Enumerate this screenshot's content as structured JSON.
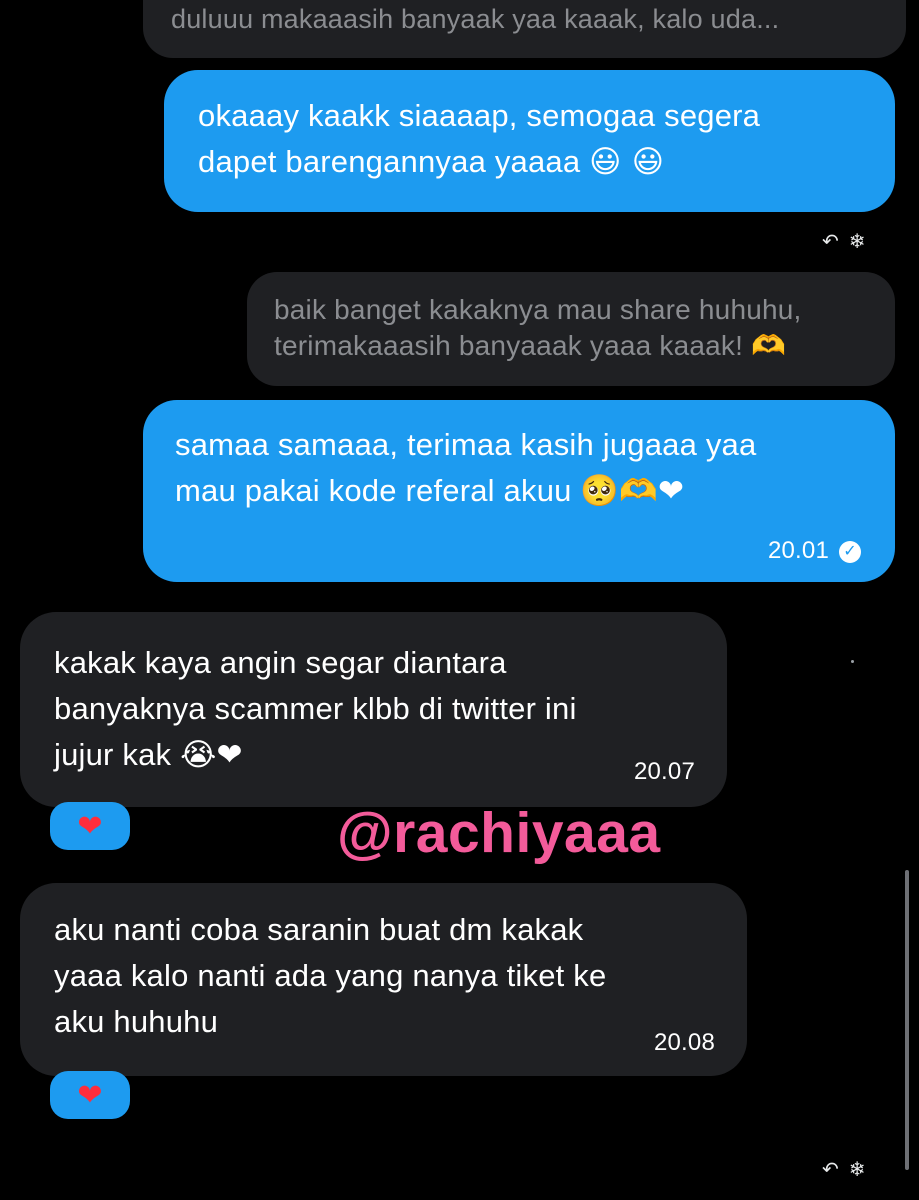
{
  "conversation": {
    "quoted_top": "duluuu makaaasih banyaak yaa kaaak, kalo uda...",
    "messages": [
      {
        "id": "msg1",
        "lines": [
          "okaaay kaakk siaaaap, semogaa segera",
          "dapet barengannyaa yaaaa"
        ],
        "emoji": "😃 😃"
      },
      {
        "id": "msg2",
        "lines": [
          "baik banget kakaknya mau share huhuhu,",
          "terimakaaasih banyaaak yaaa kaaak!"
        ],
        "emoji": "🫶"
      },
      {
        "id": "msg3",
        "lines": [
          "samaa samaaa, terimaa kasih jugaaa yaa",
          "mau pakai kode referal akuu"
        ],
        "emoji": "🥺🫶❤",
        "time": "20.01"
      },
      {
        "id": "msg4",
        "lines": [
          "kakak kaya angin segar diantara",
          "banyaknya scammer klbb di twitter ini",
          "jujur kak"
        ],
        "emoji": "😭❤",
        "time": "20.07",
        "reaction": "❤"
      },
      {
        "id": "msg5",
        "lines": [
          "aku nanti coba saranin buat dm kakak",
          "yaaa kalo nanti ada yang nanya tiket ke",
          "aku huhuhu"
        ],
        "time": "20.08",
        "reaction": "❤"
      }
    ]
  },
  "watermark": "@rachiyaaa",
  "icons": {
    "reply": "reply-icon",
    "react": "react-icon",
    "read_receipt": "check-circle-icon"
  },
  "colors": {
    "background": "#000000",
    "sent_bubble": "#1d9bf0",
    "received_bubble": "#1f2023",
    "watermark": "#f35b9a",
    "heart": "#ff2d3c"
  }
}
